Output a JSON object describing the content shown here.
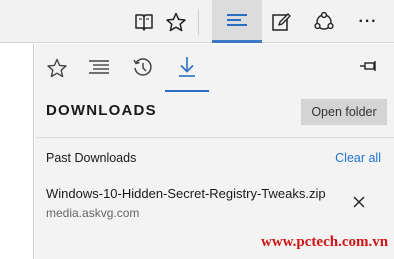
{
  "toolbar": {
    "icons": [
      "reading-view-icon",
      "favorite-star-icon",
      "hub-icon",
      "web-note-icon",
      "share-icon",
      "more-icon"
    ],
    "more_label": "···"
  },
  "hub": {
    "tabs": [
      "favorites",
      "reading-list",
      "history",
      "downloads"
    ],
    "active_tab": "downloads",
    "title": "DOWNLOADS",
    "open_folder_label": "Open folder",
    "past_label": "Past Downloads",
    "clear_all_label": "Clear all",
    "downloads": [
      {
        "filename": "Windows-10-Hidden-Secret-Registry-Tweaks.zip",
        "source": "media.askvg.com"
      }
    ]
  },
  "watermark": "www.pctech.com.vn",
  "colors": {
    "accent": "#2b6ec3",
    "link": "#1f74d6",
    "watermark": "#d21414"
  }
}
